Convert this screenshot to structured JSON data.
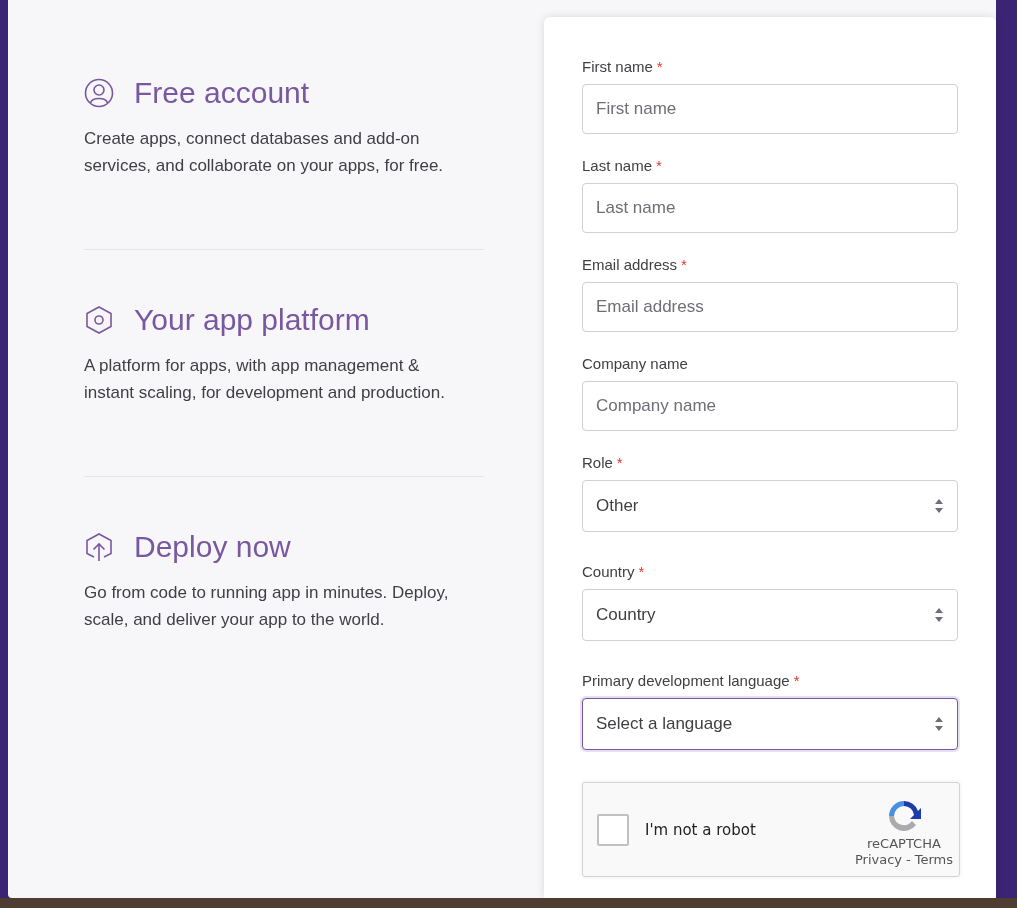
{
  "features": [
    {
      "kind": "account",
      "title": "Free account",
      "text": "Create apps, connect databases and add-on services, and collaborate on your apps, for free."
    },
    {
      "kind": "platform",
      "title": "Your app platform",
      "text": "A platform for apps, with app management & instant scaling, for development and production."
    },
    {
      "kind": "deploy",
      "title": "Deploy now",
      "text": "Go from code to running app in minutes. Deploy, scale, and deliver your app to the world."
    }
  ],
  "form": {
    "fields": [
      {
        "kind": "input",
        "label": "First name",
        "required": true,
        "placeholder": "First name",
        "focused": false
      },
      {
        "kind": "input",
        "label": "Last name",
        "required": true,
        "placeholder": "Last name",
        "focused": false
      },
      {
        "kind": "input",
        "label": "Email address",
        "required": true,
        "placeholder": "Email address",
        "focused": false
      },
      {
        "kind": "input",
        "label": "Company name",
        "required": false,
        "placeholder": "Company name",
        "focused": false
      },
      {
        "kind": "select",
        "label": "Role",
        "required": true,
        "value": "Other",
        "focused": false
      },
      {
        "kind": "select",
        "label": "Country",
        "required": true,
        "value": "Country",
        "focused": false
      },
      {
        "kind": "select",
        "label": "Primary development language",
        "required": true,
        "value": "Select a language",
        "focused": true
      }
    ],
    "required_mark": "*",
    "captcha": {
      "checked": false,
      "label": "I'm not a robot",
      "brand": "reCAPTCHA",
      "privacy": "Privacy",
      "separator": "-",
      "terms": "Terms"
    }
  }
}
